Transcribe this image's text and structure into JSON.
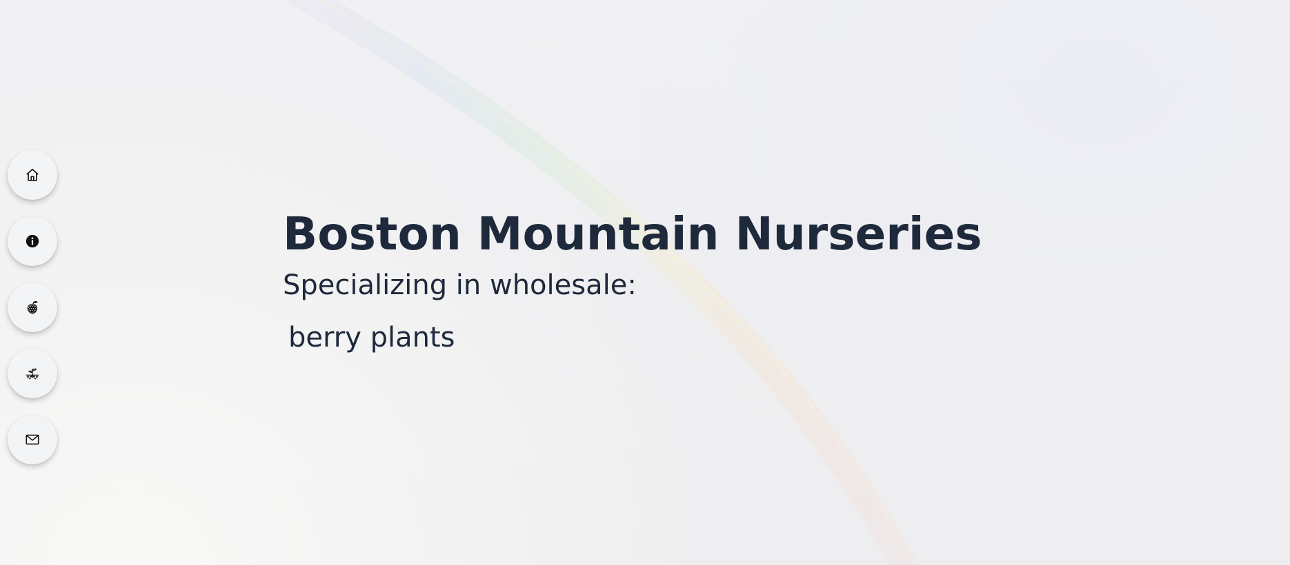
{
  "nav": {
    "items": [
      {
        "id": "home",
        "icon": "home-icon"
      },
      {
        "id": "about",
        "icon": "info-icon"
      },
      {
        "id": "berries",
        "icon": "berry-icon"
      },
      {
        "id": "plants",
        "icon": "seedling-icon"
      },
      {
        "id": "contact",
        "icon": "mail-icon"
      }
    ]
  },
  "hero": {
    "title": "Boston Mountain Nurseries",
    "subtitle": "Specializing in wholesale:",
    "rotating_text": "berry plants"
  },
  "colors": {
    "text": "#1e293b",
    "button_bg": "#f3f4f6",
    "background": "#f0f0f2"
  }
}
